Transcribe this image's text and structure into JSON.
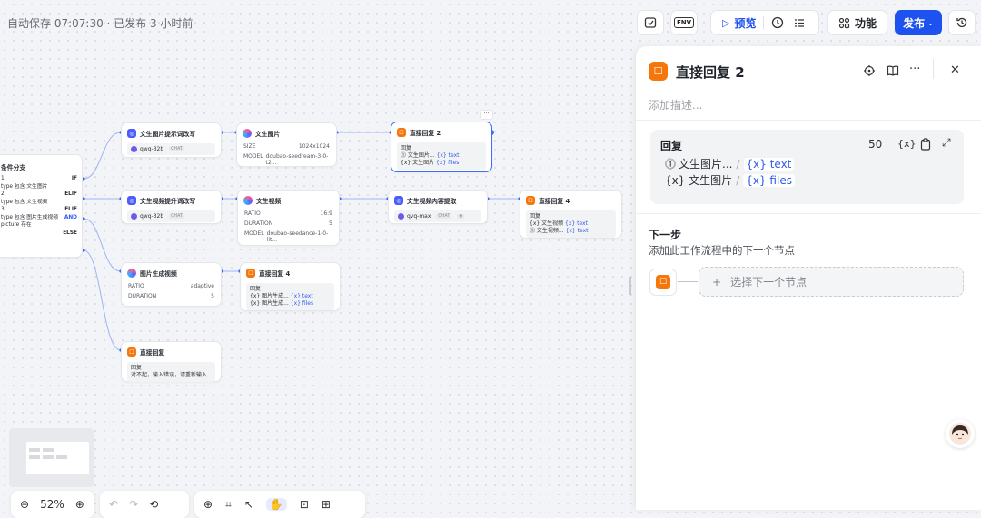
{
  "header": {
    "autosave": "自动保存 07:07:30 · 已发布 3 小时前",
    "env_label": "ENV",
    "preview_label": "预览",
    "features_label": "功能",
    "publish_label": "发布"
  },
  "canvas": {
    "condition": {
      "title": "条件分支",
      "rows": [
        {
          "left": "1",
          "right": "IF"
        },
        {
          "left": "type 包含 文生图片",
          "right": ""
        },
        {
          "left": "2",
          "right": "ELIF"
        },
        {
          "left": "type 包含 文生视频",
          "right": ""
        },
        {
          "left": "3",
          "right": "ELIF"
        },
        {
          "left": "type 包含 图片生成视频",
          "right": "AND"
        },
        {
          "left": "picture 存在",
          "right": ""
        },
        {
          "left": "",
          "right": "ELSE"
        }
      ]
    },
    "n_prompt_img": {
      "title": "文生图片提示词改写",
      "model": "qwq-32b",
      "chip": "CHAT"
    },
    "n_txt2img": {
      "title": "文生图片",
      "size_label": "SIZE",
      "size_value": "1024x1024",
      "model_label": "MODEL",
      "model_value": "doubao-seedream-3-0-t2..."
    },
    "n_reply2": {
      "title": "直接回复 2",
      "box_label": "回复",
      "line1": "⓵ 文生图片...",
      "line1_var": "{x} text",
      "line2": "{x} 文生图片",
      "line2_var": "{x} files",
      "more": "···"
    },
    "n_prompt_vid": {
      "title": "文生视频提升词改写",
      "model": "qwq-32b",
      "chip": "CHAT"
    },
    "n_txt2vid": {
      "title": "文生视频",
      "ratio_label": "RATIO",
      "ratio_value": "16:9",
      "dur_label": "DURATION",
      "dur_value": "5",
      "model_label": "MODEL",
      "model_value": "doubao-seedance-1-0-lit..."
    },
    "n_vid_extract": {
      "title": "文生视频内容提取",
      "model": "qvq-max",
      "chip": "CHAT"
    },
    "n_reply4a": {
      "title": "直接回复 4",
      "box_label": "回复",
      "line1": "{x} 文生视频",
      "line1_var": "{x} text",
      "line2": "⓵ 文生视频...",
      "line2_var": "{x} text"
    },
    "n_img2vid": {
      "title": "图片生成视频",
      "ratio_label": "RATIO",
      "ratio_value": "adaptive",
      "dur_label": "DURATION",
      "dur_value": "5"
    },
    "n_reply4b": {
      "title": "直接回复 4",
      "box_label": "回复",
      "line1": "{x} 图片生成...",
      "line1_var": "{x} text",
      "line2": "{x} 图片生成...",
      "line2_var": "{x} files"
    },
    "n_reply_else": {
      "title": "直接回复",
      "box_label": "回复",
      "line1": "对不起，输入错误，请重新输入"
    }
  },
  "panel": {
    "title": "直接回复 2",
    "desc_placeholder": "添加描述...",
    "reply_label": "回复",
    "reply_count": "50",
    "var_label": "{x}",
    "var1_text": "文生图片...",
    "var1_slash": "/",
    "var1_tag": "{x} text",
    "var2_text": "{x} 文生图片",
    "var2_slash": "/",
    "var2_tag": "{x} files",
    "next_title": "下一步",
    "next_desc": "添加此工作流程中的下一个节点",
    "next_btn": "选择下一个节点"
  },
  "bottom": {
    "zoom": "52%"
  }
}
